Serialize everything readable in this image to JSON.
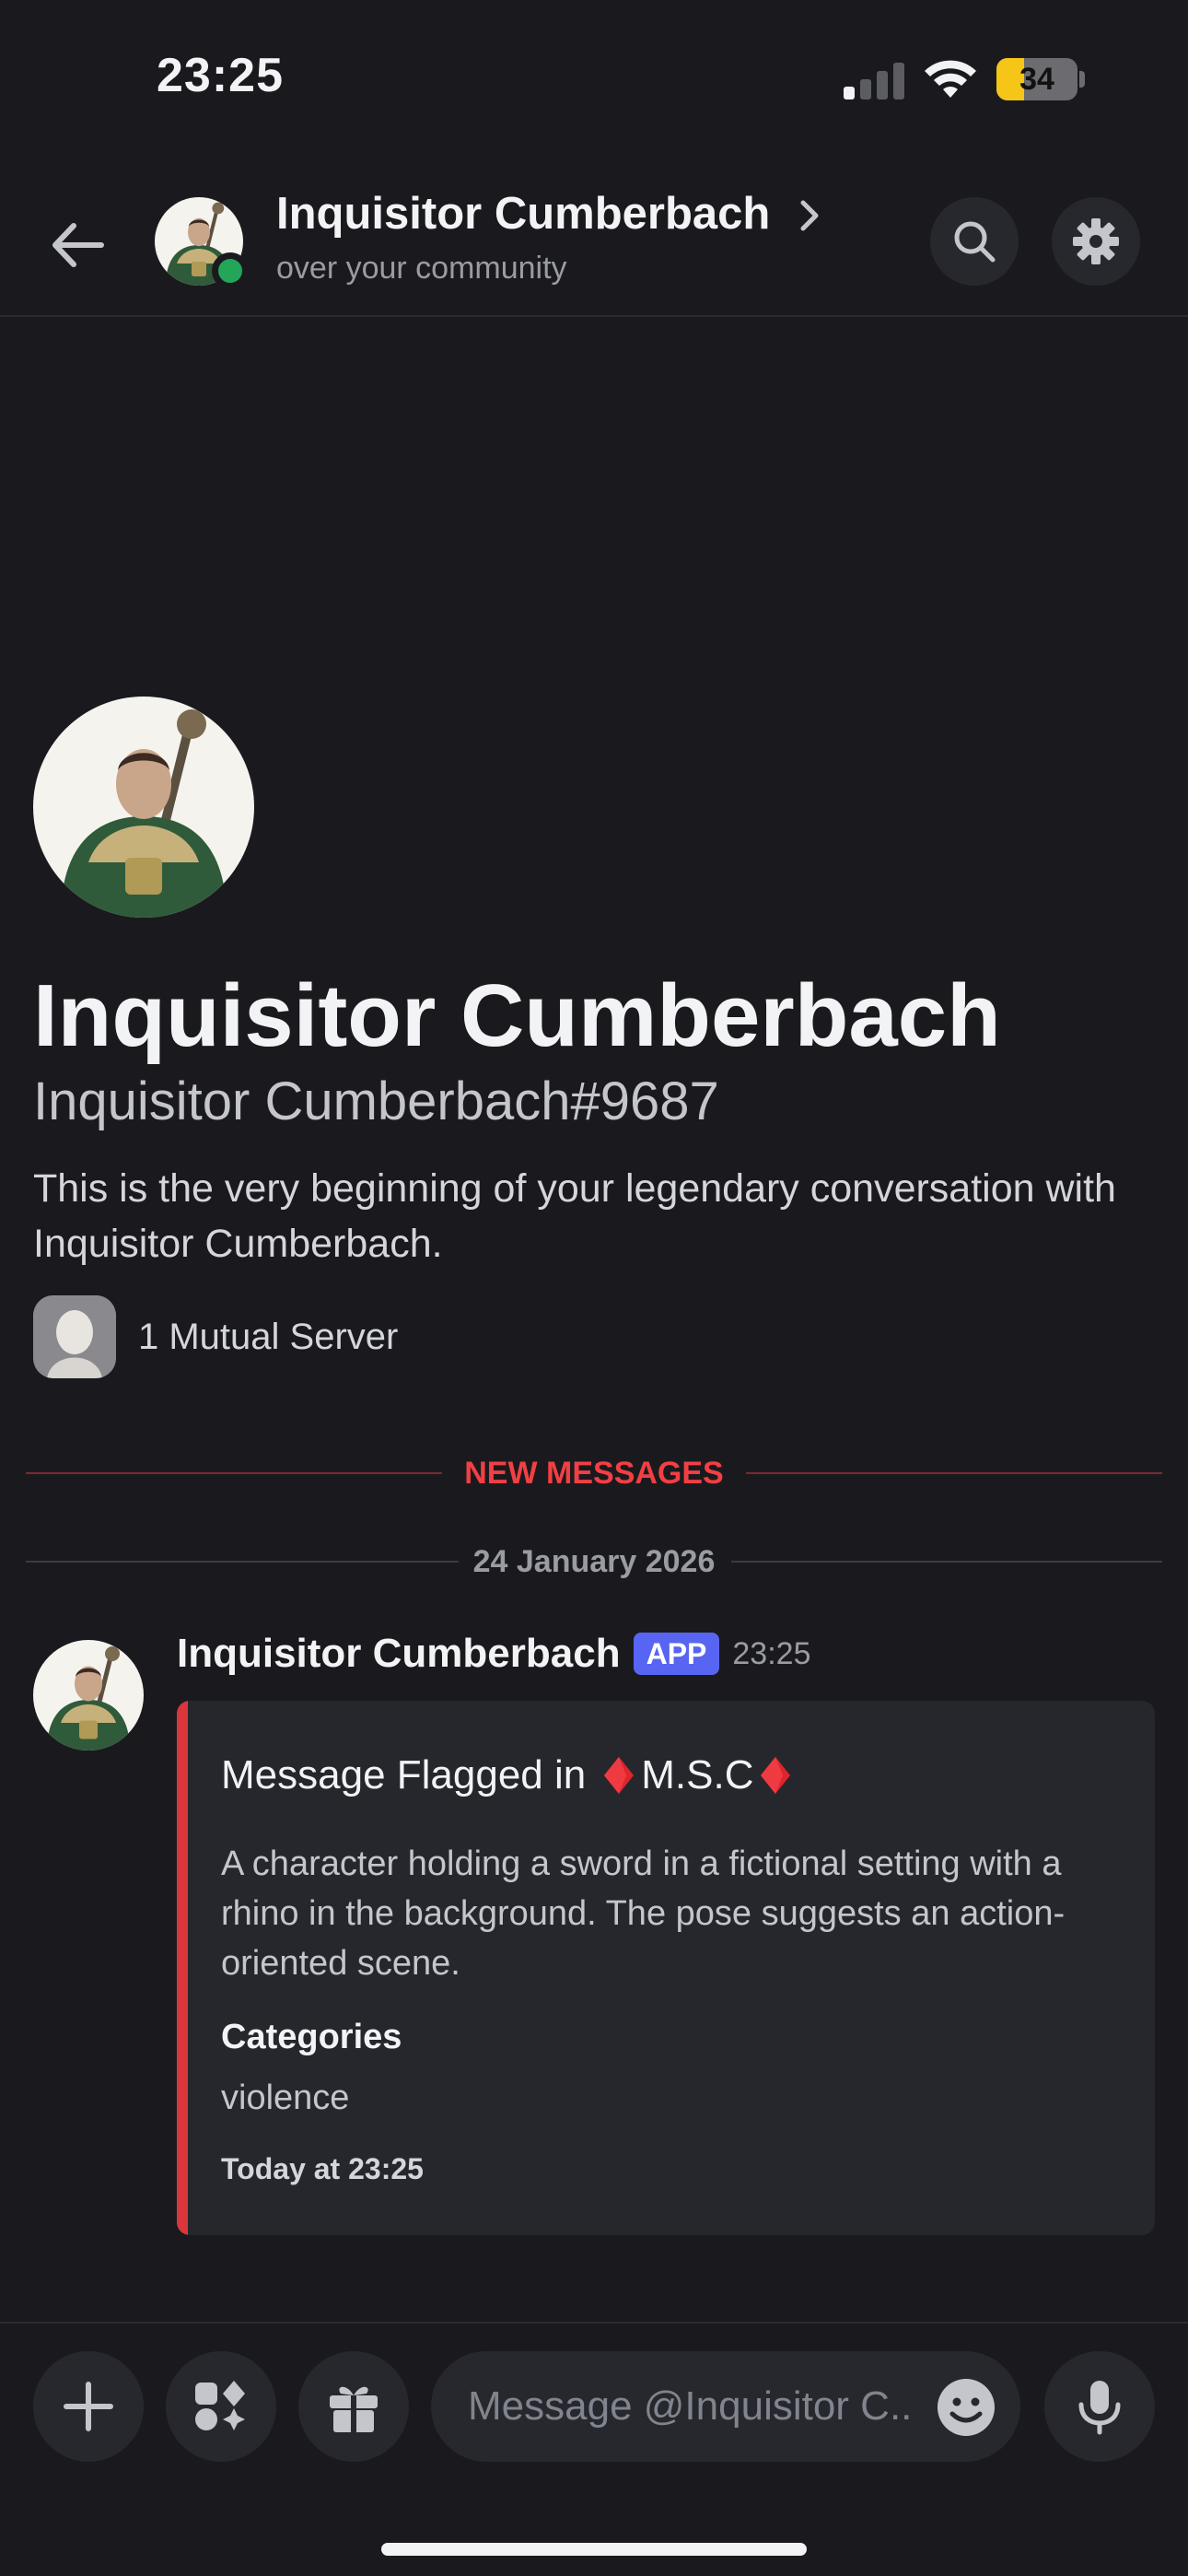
{
  "status_bar": {
    "time": "23:25",
    "battery_level": "34",
    "battery_fraction": 0.34
  },
  "header": {
    "name": "Inquisitor Cumberbach",
    "subtitle": "over your community",
    "presence": "online"
  },
  "profile": {
    "display_name": "Inquisitor Cumberbach",
    "tag": "Inquisitor Cumberbach#9687",
    "intro": "This is the very beginning of your legendary conversation with Inquisitor Cumberbach.",
    "mutual_servers": "1 Mutual Server"
  },
  "dividers": {
    "new_messages": "NEW MESSAGES",
    "date": "24 January 2026"
  },
  "message": {
    "author": "Inquisitor Cumberbach",
    "badge": "APP",
    "time": "23:25",
    "embed": {
      "title_prefix": "Message Flagged in",
      "title_server": "M.S.C",
      "title_emoji": "red-diamond-icon",
      "description": "A character holding a sword in a fictional setting with a rhino in the background. The pose suggests an action-oriented scene.",
      "field_name": "Categories",
      "field_value": "violence",
      "footer": "Today at 23:25",
      "accent_color": "#da373c"
    }
  },
  "composer": {
    "placeholder": "Message @Inquisitor C..."
  },
  "colors": {
    "background": "#1a1a1e",
    "online": "#23a55a",
    "badge": "#5865f2",
    "new_messages": "#f23f43"
  }
}
